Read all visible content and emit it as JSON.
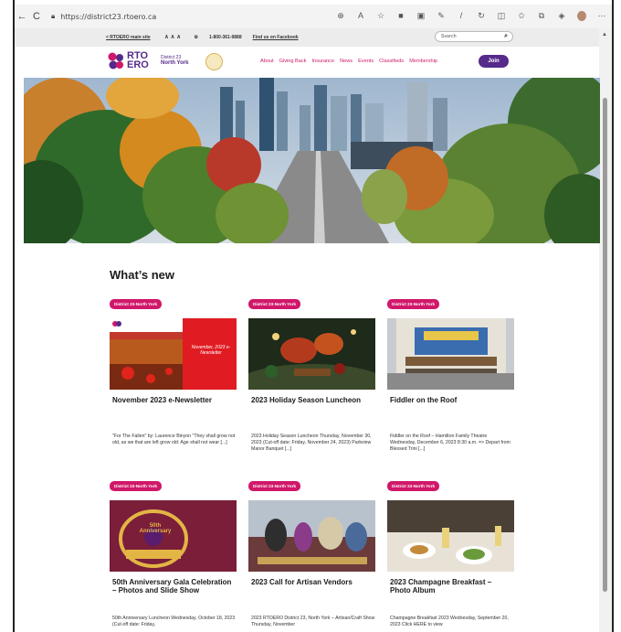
{
  "browser": {
    "url": "https://district23.rtoero.ca",
    "nav": [
      "←",
      "C"
    ]
  },
  "utility": {
    "back_link": "< RTOERO main site",
    "font_sizes": "A A A",
    "phone": "1-800-361-9888",
    "facebook": "Find us on Facebook",
    "search_placeholder": "Search"
  },
  "header": {
    "logo_line1": "RTO",
    "logo_line2": "ERO",
    "district": "District 23",
    "region": "North York",
    "nav": [
      "About",
      "Giving Back",
      "Insurance",
      "News",
      "Events",
      "Classifieds",
      "Membership"
    ],
    "join": "Join"
  },
  "section_title": "What’s new",
  "cards": [
    {
      "tag": "District 23-North York",
      "title": "November 2023 e-Newsletter",
      "excerpt": "\"For The Fallen\" by: Laurence Binyon \"They shall grow not old, as we that are left grow old: Age shall not wear [...]",
      "thumb_text": "November, 2023 e-Newsletter"
    },
    {
      "tag": "District 23-North York",
      "title": "2023 Holiday Season Luncheon",
      "excerpt": "2023 Holiday Season Luncheon Thursday, November 30, 2023 (Cut-off date: Friday, November 24, 2023) Parkview Manor Banquet [...]"
    },
    {
      "tag": "District 23-North York",
      "title": "Fiddler on the Roof",
      "excerpt": "Fiddler on the Roof – Hamilton Family Theatre Wednesday, December 6, 2023 8:30 a.m. => Depart from Blessed Trini [...]"
    },
    {
      "tag": "District 23-North York",
      "title": "50th Anniversary Gala Celebration – Photos and Slide Show",
      "excerpt": "50th Anniversary Luncheon Wednesday, October 18, 2023 (Cut-off date: Friday,",
      "thumb_text": "50th Anniversary"
    },
    {
      "tag": "District 23-North York",
      "title": "2023 Call for Artisan Vendors",
      "excerpt": "2023 RTOERO District 23, North York – Artisan/Craft Show Thursday, November"
    },
    {
      "tag": "District 23-North York",
      "title": "2023 Champagne Breakfast – Photo Album",
      "excerpt": "Champagne Breakfast 2023 Wednesday, September 20, 2023 Click HERE to view"
    }
  ],
  "colors": {
    "brand_purple": "#552a8b",
    "brand_pink": "#d0186a"
  }
}
